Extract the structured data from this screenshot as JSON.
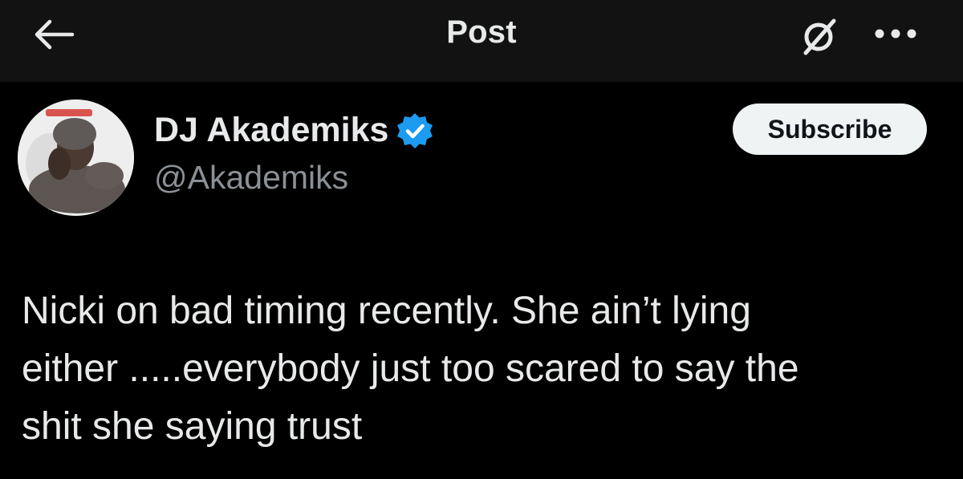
{
  "header": {
    "title": "Post",
    "back_icon": "arrow-left-icon",
    "grok_icon": "grok-slash-icon",
    "more_icon": "more-horizontal-icon"
  },
  "author": {
    "display_name": "DJ Akademiks",
    "handle": "@Akademiks",
    "verified_icon": "verified-badge-icon",
    "verified_color": "#1d9bf0"
  },
  "actions": {
    "subscribe_label": "Subscribe"
  },
  "post": {
    "text": "Nicki on bad timing recently. She ain’t lying\neither .....everybody just too scared to say the\nshit she saying trust"
  },
  "colors": {
    "background": "#000000",
    "header_background": "#121212",
    "primary_text": "#e7e9ea",
    "secondary_text": "#8b9096",
    "button_background": "#eff3f4"
  }
}
